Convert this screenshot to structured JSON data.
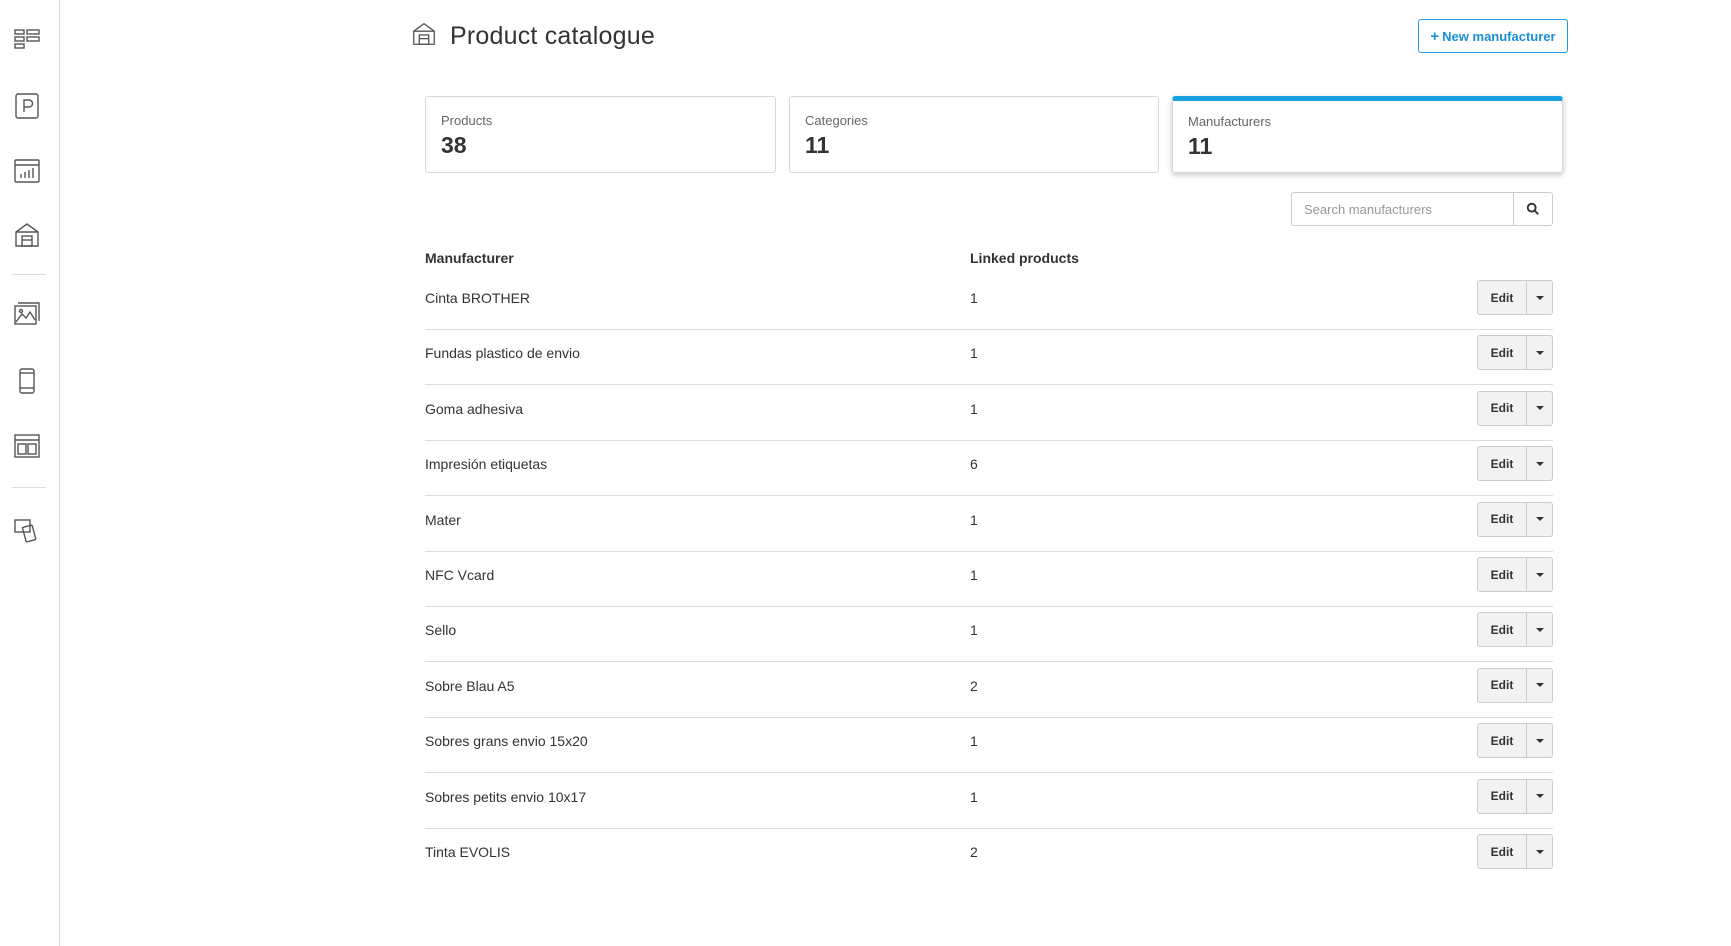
{
  "sidebar": {
    "icons": [
      "dashboard-icon",
      "parking-icon",
      "stats-icon",
      "store-icon",
      "gallery-icon",
      "mobile-icon",
      "layout-icon",
      "devices-icon"
    ]
  },
  "header": {
    "title": "Product catalogue",
    "title_icon": "store-icon",
    "new_button_label": "New manufacturer",
    "new_button_icon": "+"
  },
  "stats": [
    {
      "label": "Products",
      "value": "38"
    },
    {
      "label": "Categories",
      "value": "11"
    },
    {
      "label": "Manufacturers",
      "value": "11"
    }
  ],
  "active_stat": "Manufacturers",
  "search": {
    "placeholder": "Search manufacturers"
  },
  "table": {
    "columns": [
      "Manufacturer",
      "Linked products"
    ],
    "edit_label": "Edit",
    "rows": [
      {
        "name": "Cinta BROTHER",
        "count": "1"
      },
      {
        "name": "Fundas plastico de envio",
        "count": "1"
      },
      {
        "name": "Goma adhesiva",
        "count": "1"
      },
      {
        "name": "Impresión etiquetas",
        "count": "6"
      },
      {
        "name": "Mater",
        "count": "1"
      },
      {
        "name": "NFC Vcard",
        "count": "1"
      },
      {
        "name": "Sello",
        "count": "1"
      },
      {
        "name": "Sobre Blau A5",
        "count": "2"
      },
      {
        "name": "Sobres grans envio 15x20",
        "count": "1"
      },
      {
        "name": "Sobres petits envio 10x17",
        "count": "1"
      },
      {
        "name": "Tinta EVOLIS",
        "count": "2"
      }
    ]
  },
  "colors": {
    "accent": "#1ba1e2",
    "border": "#d8d8d8",
    "text": "#333333"
  }
}
